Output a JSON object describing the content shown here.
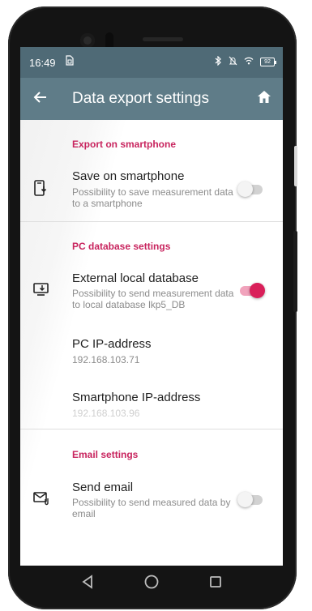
{
  "status_bar": {
    "time": "16:49",
    "sim_icon": "sim-icon",
    "battery": "92"
  },
  "app_bar": {
    "title": "Data export settings",
    "back_icon": "arrow-back-icon",
    "home_icon": "home-icon"
  },
  "sections": {
    "export": {
      "title": "Export on smartphone",
      "save": {
        "title": "Save on smartphone",
        "subtitle": "Possibility to save measurement data to a smartphone",
        "enabled": false
      }
    },
    "pc": {
      "title": "PC database settings",
      "external": {
        "title": "External local database",
        "subtitle": "Possibility to send measurement data to local database lkp5_DB",
        "enabled": true
      },
      "pc_ip": {
        "title": "PC IP-address",
        "value": "192.168.103.71"
      },
      "phone_ip": {
        "title": "Smartphone IP-address",
        "value": "192.168.103.96"
      }
    },
    "email": {
      "title": "Email settings",
      "send": {
        "title": "Send email",
        "subtitle": "Possibility to send measured data by email",
        "enabled": false
      }
    }
  },
  "colors": {
    "statusbar": "#4f6a76",
    "appbar": "#5f7c88",
    "accent": "#c8245e",
    "switch_on": "#d91f59"
  }
}
